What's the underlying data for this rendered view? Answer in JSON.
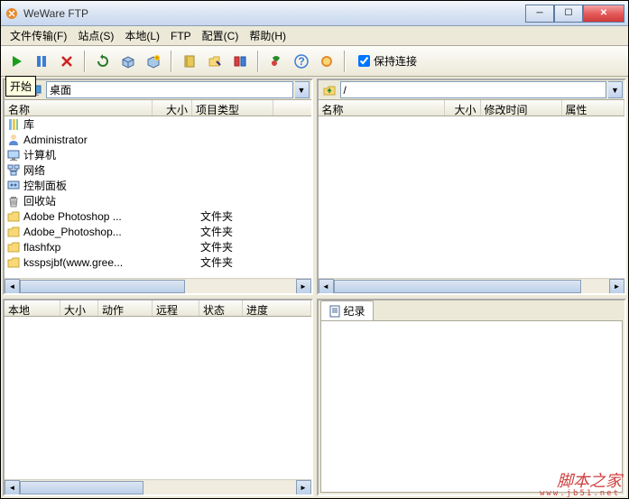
{
  "title": "WeWare FTP",
  "menus": [
    "文件传输(F)",
    "站点(S)",
    "本地(L)",
    "FTP",
    "配置(C)",
    "帮助(H)"
  ],
  "tooltip_start": "开始",
  "keep_connection": "保持连接",
  "local": {
    "path": "桌面",
    "cols": [
      "名称",
      "大小",
      "项目类型"
    ],
    "items": [
      {
        "icon": "lib",
        "name": "库",
        "type": ""
      },
      {
        "icon": "user",
        "name": "Administrator",
        "type": ""
      },
      {
        "icon": "computer",
        "name": "计算机",
        "type": ""
      },
      {
        "icon": "network",
        "name": "网络",
        "type": ""
      },
      {
        "icon": "cp",
        "name": "控制面板",
        "type": ""
      },
      {
        "icon": "recycle",
        "name": "回收站",
        "type": ""
      },
      {
        "icon": "folder",
        "name": "Adobe Photoshop ...",
        "type": "文件夹"
      },
      {
        "icon": "folder",
        "name": "Adobe_Photoshop...",
        "type": "文件夹"
      },
      {
        "icon": "folder",
        "name": "flashfxp",
        "type": "文件夹"
      },
      {
        "icon": "folder",
        "name": "ksspsjbf(www.gree...",
        "type": "文件夹"
      }
    ]
  },
  "remote": {
    "path": "/",
    "cols": [
      "名称",
      "大小",
      "修改时间",
      "属性"
    ]
  },
  "queue_cols": [
    "本地",
    "大小",
    "动作",
    "远程",
    "状态",
    "进度"
  ],
  "log_tab": "纪录",
  "watermark": "脚本之家",
  "watermark_url": "www.jb51.net"
}
